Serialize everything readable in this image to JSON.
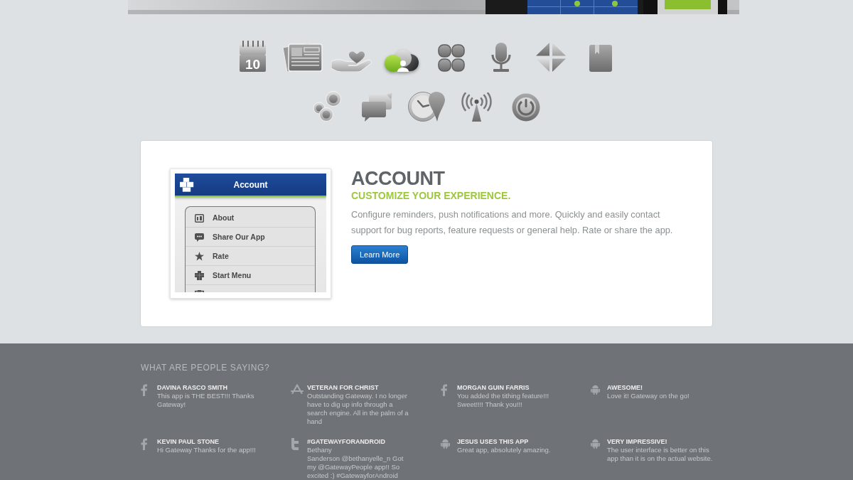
{
  "feature_icons": [
    {
      "kind": "calendar",
      "text": "10",
      "selected": false
    },
    {
      "kind": "newspaper",
      "selected": false
    },
    {
      "kind": "hand-heart",
      "selected": false
    },
    {
      "kind": "people",
      "selected": true
    },
    {
      "kind": "clover",
      "selected": false
    },
    {
      "kind": "microphone",
      "selected": false
    },
    {
      "kind": "arrows",
      "selected": false
    },
    {
      "kind": "book",
      "selected": false
    },
    {
      "kind": "bubbles",
      "selected": false
    },
    {
      "kind": "chat",
      "selected": false
    },
    {
      "kind": "clock-pin",
      "selected": false
    },
    {
      "kind": "antenna",
      "selected": false
    },
    {
      "kind": "power",
      "selected": false
    }
  ],
  "feature": {
    "preview": {
      "title": "Account",
      "items": [
        {
          "kind": "info",
          "label": "About"
        },
        {
          "kind": "chat",
          "label": "Share Our App"
        },
        {
          "kind": "star",
          "label": "Rate"
        },
        {
          "kind": "blocks",
          "label": "Start Menu"
        },
        {
          "kind": "clipboard"
        }
      ]
    },
    "title": "ACCOUNT",
    "subtitle": "CUSTOMIZE YOUR EXPERIENCE.",
    "description": "Configure reminders, push notifications and more. Quickly and easily contact support for bug reports, feature requests or general help. Rate or share the app.",
    "button": "Learn More"
  },
  "testimonials": {
    "heading": "WHAT ARE PEOPLE SAYING?",
    "items": [
      {
        "kind": "facebook",
        "name": "DAVINA RASCO SMITH",
        "text": "This app is THE BEST!!! Thanks Gateway!"
      },
      {
        "kind": "appstore",
        "name": "VETERAN FOR CHRIST",
        "text": "Outstanding Gateway. I no longer have to dig up info through a search engine. All in the palm of a hand"
      },
      {
        "kind": "facebook",
        "name": "MORGAN GUIN FARRIS",
        "text": "You added the tithing feature!!! Sweet!!!! Thank you!!!"
      },
      {
        "kind": "android",
        "name": "AWESOME!",
        "text": "Love it! Gateway on the go!"
      },
      {
        "kind": "facebook",
        "name": "KEVIN PAUL STONE",
        "text": "Hi Gateway Thanks for the app!!!"
      },
      {
        "kind": "twitter",
        "name": "#GATEWAYFORANDROID",
        "text": "Bethany\nSanderson @bethanyelle_n Got my @GatewayPeople app!! So excited :) #GatewayforAndroid"
      },
      {
        "kind": "android",
        "name": "JESUS USES THIS APP",
        "text": "Great app, absolutely amazing."
      },
      {
        "kind": "android",
        "name": "VERY IMPRESSIVE!",
        "text": "The user interface is better on this app than it is on the actual website."
      }
    ]
  }
}
